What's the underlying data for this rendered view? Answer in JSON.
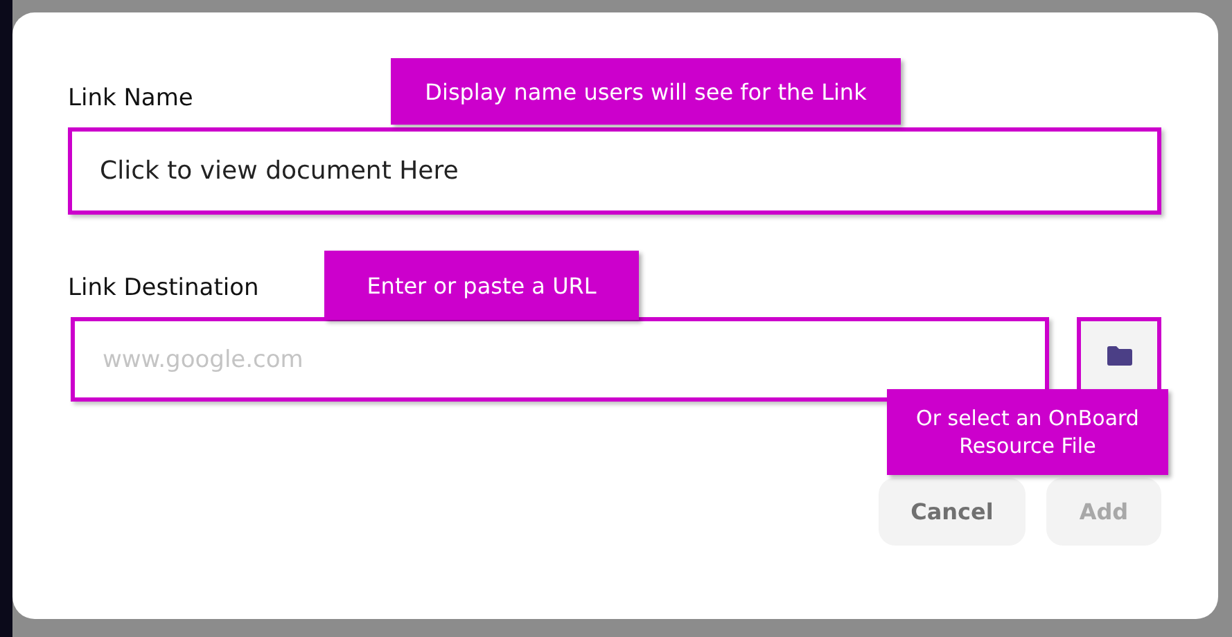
{
  "fields": [
    {
      "label": "Link Name",
      "value": "Click to view document Here",
      "callout": "Display name users will see for the Link"
    },
    {
      "label": "Link Destination",
      "placeholder": "www.google.com",
      "callout": "Enter or paste a URL",
      "file_button": true,
      "file_callout": "Or select an OnBoard Resource File"
    }
  ],
  "buttons": [
    {
      "label": "Cancel",
      "disabled": false
    },
    {
      "label": "Add",
      "disabled": true
    }
  ]
}
